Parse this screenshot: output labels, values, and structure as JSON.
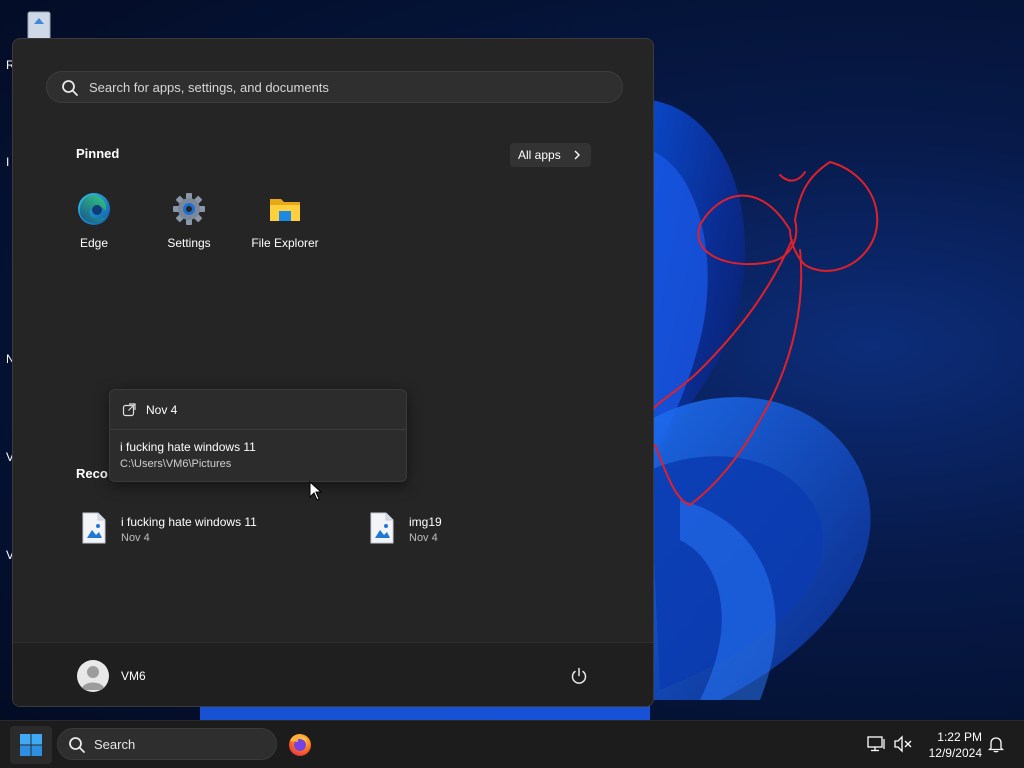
{
  "desktop": {
    "left_edge_letters": [
      "R",
      "I",
      "N",
      "V",
      "V"
    ]
  },
  "start_menu": {
    "search_placeholder": "Search for apps, settings, and documents",
    "pinned_title": "Pinned",
    "all_apps_label": "All apps",
    "pinned_apps": [
      {
        "label": "Edge",
        "icon": "edge-icon"
      },
      {
        "label": "Settings",
        "icon": "settings-gear-icon"
      },
      {
        "label": "File Explorer",
        "icon": "folder-icon"
      }
    ],
    "recommended_title": "Reco",
    "recommended": [
      {
        "name": "i fucking hate windows 11",
        "date": "Nov 4",
        "icon": "image-file-icon"
      },
      {
        "name": "img19",
        "date": "Nov 4",
        "icon": "image-file-icon"
      }
    ],
    "tooltip": {
      "date": "Nov 4",
      "name": "i fucking hate windows 11",
      "path": "C:\\Users\\VM6\\Pictures"
    },
    "user": {
      "name": "VM6"
    }
  },
  "taskbar": {
    "search_label": "Search",
    "time": "1:22 PM",
    "date": "12/9/2024"
  },
  "colors": {
    "accent_blue": "#1a7fe0",
    "menu_bg": "#252525",
    "drawing_red": "#e0202a"
  }
}
